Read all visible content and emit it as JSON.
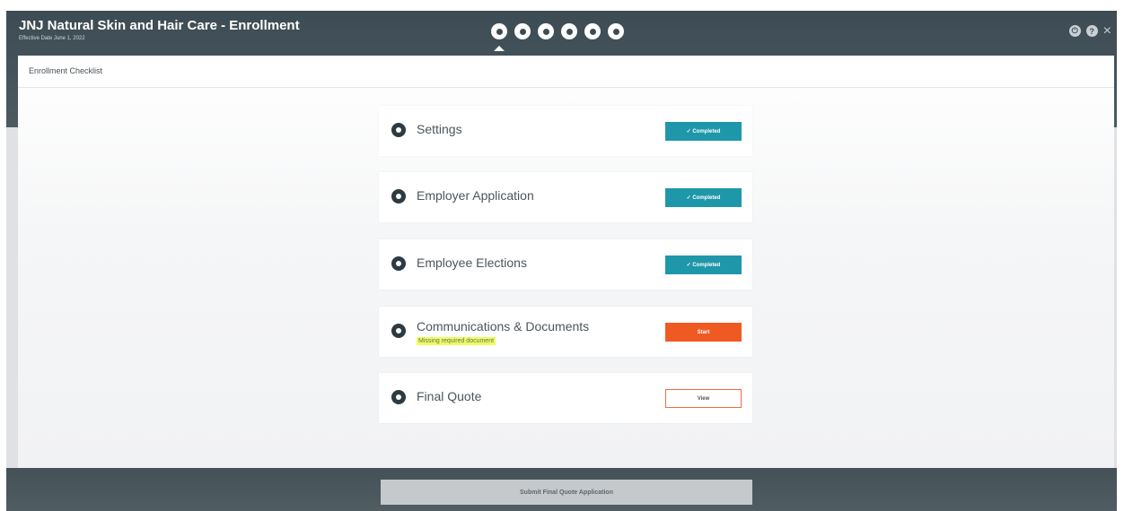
{
  "header": {
    "title": "JNJ Natural Skin and Hair Care - Enrollment",
    "effective_date": "Effective Date June 1, 2022"
  },
  "panel": {
    "title": "Enrollment Checklist"
  },
  "checklist": [
    {
      "label": "Settings",
      "status": "✓ Completed",
      "state": "completed",
      "icon": "settings-icon"
    },
    {
      "label": "Employer Application",
      "status": "✓ Completed",
      "state": "completed",
      "icon": "employer-icon"
    },
    {
      "label": "Employee Elections",
      "status": "✓ Completed",
      "state": "completed",
      "icon": "elections-icon"
    },
    {
      "label": "Communications & Documents",
      "sublabel": "Missing required document",
      "status": "Start",
      "state": "start",
      "icon": "documents-icon"
    },
    {
      "label": "Final Quote",
      "status": "View",
      "state": "view",
      "icon": "quote-icon"
    }
  ],
  "footer": {
    "submit_label": "Submit Final Quote Application"
  },
  "colors": {
    "header": "#3d4c54",
    "completed": "#1f97aa",
    "start": "#ef5a22",
    "highlight": "#eeff5a"
  }
}
